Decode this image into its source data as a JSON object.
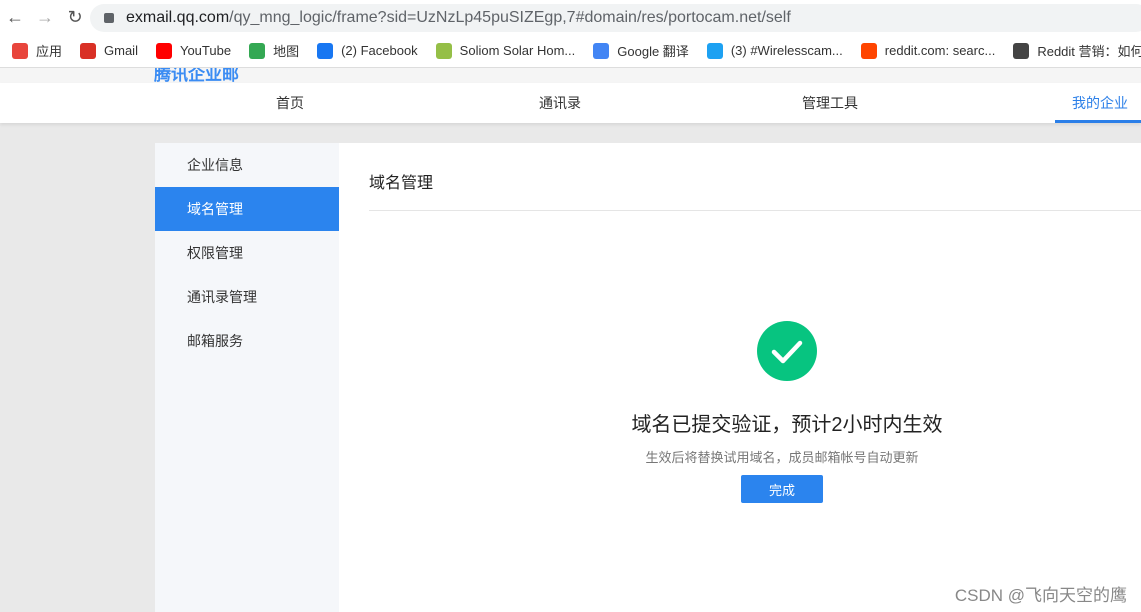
{
  "browser": {
    "url_host": "exmail.qq.com",
    "url_path": "/qy_mng_logic/frame?sid=UzNzLp45puSIZEgp,7#domain/res/portocam.net/self"
  },
  "bookmarks": [
    {
      "label": "应用",
      "color": "#e8453c"
    },
    {
      "label": "Gmail",
      "color": "#d93025"
    },
    {
      "label": "YouTube",
      "color": "#ff0000"
    },
    {
      "label": "地图",
      "color": "#34a853"
    },
    {
      "label": "(2) Facebook",
      "color": "#1877f2"
    },
    {
      "label": "Soliom Solar Hom...",
      "color": "#95bf47"
    },
    {
      "label": "Google 翻译",
      "color": "#4285f4"
    },
    {
      "label": "(3) #Wirelesscam...",
      "color": "#1da1f2"
    },
    {
      "label": "reddit.com: searc...",
      "color": "#ff4500"
    },
    {
      "label": "Reddit 营销：如何...",
      "color": "#444444"
    }
  ],
  "topnav": [
    "首页",
    "通讯录",
    "管理工具",
    "我的企业"
  ],
  "sidebar": [
    "企业信息",
    "域名管理",
    "权限管理",
    "通讯录管理",
    "邮箱服务"
  ],
  "main": {
    "title": "域名管理",
    "message": "域名已提交验证，预计2小时内生效",
    "submessage": "生效后将替换试用域名，成员邮箱帐号自动更新",
    "done_label": "完成"
  },
  "watermark": "CSDN @飞向天空的鹰",
  "colors": {
    "accent": "#2b84ee",
    "success": "#07c480"
  }
}
